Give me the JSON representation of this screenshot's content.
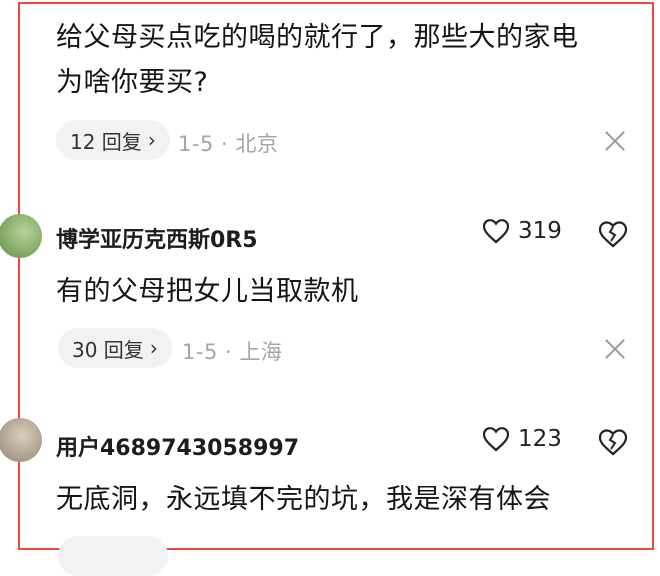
{
  "comment1": {
    "text_line1": "给父母买点吃的喝的就行了，那些大的家电",
    "text_line2": "为啥你要买?",
    "reply_label": "12 回复",
    "date": "1-5",
    "separator": "·",
    "location": "北京"
  },
  "comment2": {
    "username": "博学亚历克西斯0R5",
    "likes": "319",
    "text": "有的父母把女儿当取款机",
    "reply_label": "30 回复",
    "date": "1-5",
    "separator": "·",
    "location": "上海"
  },
  "comment3": {
    "username": "用户4689743058997",
    "likes": "123",
    "text": "无底洞，永远填不完的坑，我是深有体会"
  },
  "colors": {
    "frame": "#e8483f",
    "meta": "#a5a5a5",
    "pill_bg": "#f2f2f2"
  },
  "icons": [
    "heart-icon",
    "broken-heart-icon",
    "close-icon",
    "chevron-right-icon"
  ]
}
